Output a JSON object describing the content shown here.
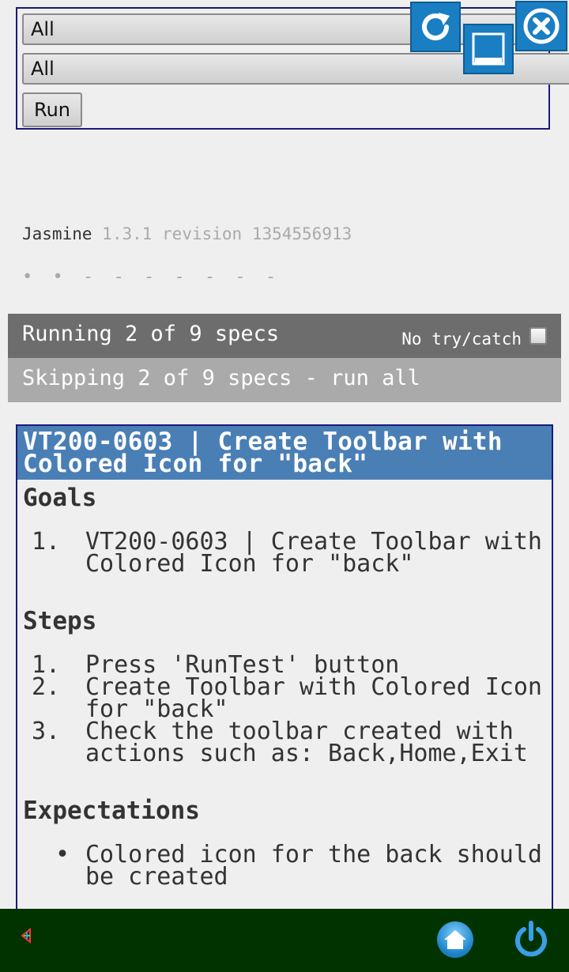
{
  "controls": {
    "select1_value": "All",
    "select2_value": "All",
    "run_label": "Run"
  },
  "window_buttons": {
    "reload_icon": "reload-icon",
    "minimize_icon": "minimize-icon",
    "close_icon": "close-icon"
  },
  "jasmine": {
    "name": "Jasmine",
    "version": "1.3.1 revision 1354556913",
    "dots": "• • - - - - - - -"
  },
  "status": {
    "running": "Running 2 of 9 specs",
    "no_try_catch": "No try/catch",
    "skipping": "Skipping 2 of 9 specs - run all"
  },
  "spec": {
    "title": "VT200-0603 | Create Toolbar with Colored Icon for \"back\"",
    "goals_title": "Goals",
    "goals": [
      {
        "num": "1.",
        "text": "VT200-0603 | Create Toolbar with Colored Icon for \"back\""
      }
    ],
    "steps_title": "Steps",
    "steps": [
      {
        "num": "1.",
        "text": "Press 'RunTest' button"
      },
      {
        "num": "2.",
        "text": "Create Toolbar with Colored Icon for \"back\""
      },
      {
        "num": "3.",
        "text": "Check the toolbar created with actions such as: Back,Home,Exit"
      }
    ],
    "expectations_title": "Expectations",
    "expectations": [
      {
        "text": "Colored icon for the back should be created"
      }
    ]
  },
  "colors": {
    "accent": "#4a7fb6",
    "running_bar": "#6d6d6d",
    "skipping_bar": "#aaaaaa",
    "navbar": "#013300"
  }
}
